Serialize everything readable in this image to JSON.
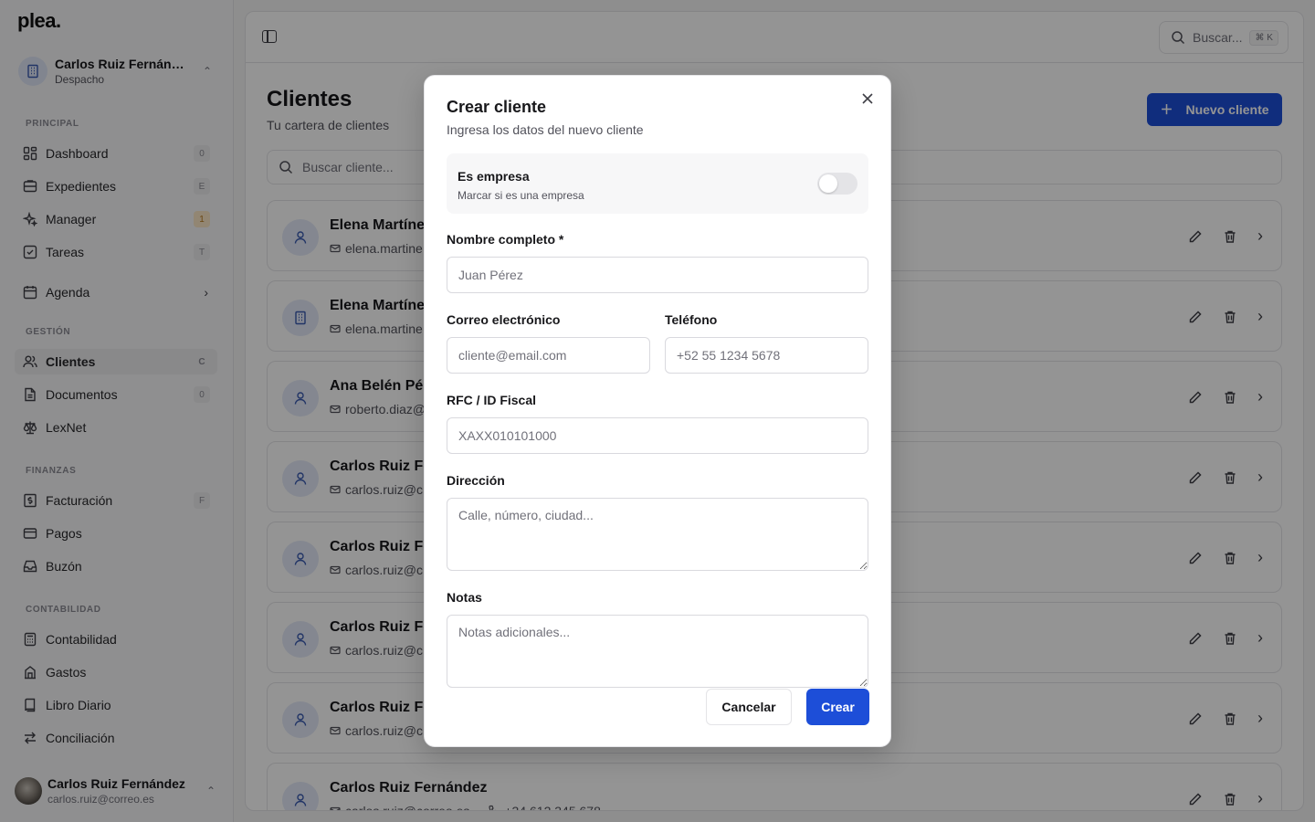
{
  "app": {
    "logo": "plea."
  },
  "org": {
    "name": "Carlos Ruiz Fernán…",
    "role": "Despacho"
  },
  "sidebar": {
    "sections": {
      "principal": "PRINCIPAL",
      "gestion": "GESTIÓN",
      "finanzas": "FINANZAS",
      "contabilidad": "CONTABILIDAD"
    },
    "items": [
      {
        "label": "Dashboard",
        "badge": "0",
        "icon": "dashboard-icon"
      },
      {
        "label": "Expedientes",
        "badge": "E",
        "icon": "folder-icon"
      },
      {
        "label": "Manager",
        "badge": "1",
        "icon": "sparkle-icon"
      },
      {
        "label": "Tareas",
        "badge": "T",
        "icon": "checkbox-icon"
      },
      {
        "label": "Agenda",
        "icon": "calendar-icon"
      },
      {
        "label": "Clientes",
        "badge": "C",
        "icon": "users-icon"
      },
      {
        "label": "Documentos",
        "badge": "0",
        "icon": "document-icon"
      },
      {
        "label": "LexNet",
        "icon": "scale-icon"
      },
      {
        "label": "Facturación",
        "badge": "F",
        "icon": "invoice-icon"
      },
      {
        "label": "Pagos",
        "icon": "card-icon"
      },
      {
        "label": "Buzón",
        "icon": "inbox-icon"
      },
      {
        "label": "Contabilidad",
        "icon": "calculator-icon"
      },
      {
        "label": "Gastos",
        "icon": "building-icon"
      },
      {
        "label": "Libro Diario",
        "icon": "book-icon"
      },
      {
        "label": "Conciliación",
        "icon": "arrows-icon"
      }
    ]
  },
  "user": {
    "name": "Carlos Ruiz Fernández",
    "email": "carlos.ruiz@correo.es"
  },
  "topbar": {
    "search_placeholder": "Buscar...",
    "shortcut": "⌘ K"
  },
  "page": {
    "title": "Clientes",
    "subtitle": "Tu cartera de clientes",
    "new_button": "Nuevo cliente",
    "search_placeholder": "Buscar cliente..."
  },
  "clients": [
    {
      "name": "Elena Martíne",
      "email": "elena.martine",
      "type": "person"
    },
    {
      "name": "Elena Martíne",
      "email": "elena.martine",
      "type": "company"
    },
    {
      "name": "Ana Belén Pér",
      "email": "roberto.diaz@",
      "type": "person"
    },
    {
      "name": "Carlos Ruiz Fe",
      "email": "carlos.ruiz@c",
      "type": "person"
    },
    {
      "name": "Carlos Ruiz Fe",
      "email": "carlos.ruiz@c",
      "type": "person"
    },
    {
      "name": "Carlos Ruiz Fe",
      "email": "carlos.ruiz@c",
      "type": "person"
    },
    {
      "name": "Carlos Ruiz Fe",
      "email": "carlos.ruiz@c",
      "type": "person"
    },
    {
      "name": "Carlos Ruiz Fernández",
      "email": "carlos.ruiz@correo.es",
      "phone": "+34 612 345 678",
      "type": "person"
    }
  ],
  "modal": {
    "title": "Crear cliente",
    "subtitle": "Ingresa los datos del nuevo cliente",
    "company_toggle": {
      "title": "Es empresa",
      "subtitle": "Marcar si es una empresa",
      "on": false
    },
    "fields": {
      "name": {
        "label": "Nombre completo *",
        "placeholder": "Juan Pérez",
        "value": ""
      },
      "email": {
        "label": "Correo electrónico",
        "placeholder": "cliente@email.com",
        "value": ""
      },
      "phone": {
        "label": "Teléfono",
        "placeholder": "+52 55 1234 5678",
        "value": ""
      },
      "rfc": {
        "label": "RFC / ID Fiscal",
        "placeholder": "XAXX010101000",
        "value": ""
      },
      "address": {
        "label": "Dirección",
        "placeholder": "Calle, número, ciudad...",
        "value": ""
      },
      "notes": {
        "label": "Notas",
        "placeholder": "Notas adicionales...",
        "value": ""
      }
    },
    "cancel_label": "Cancelar",
    "create_label": "Crear"
  },
  "colors": {
    "accent": "#1d4ed8",
    "overlay": "rgba(0,0,0,0.42)"
  }
}
